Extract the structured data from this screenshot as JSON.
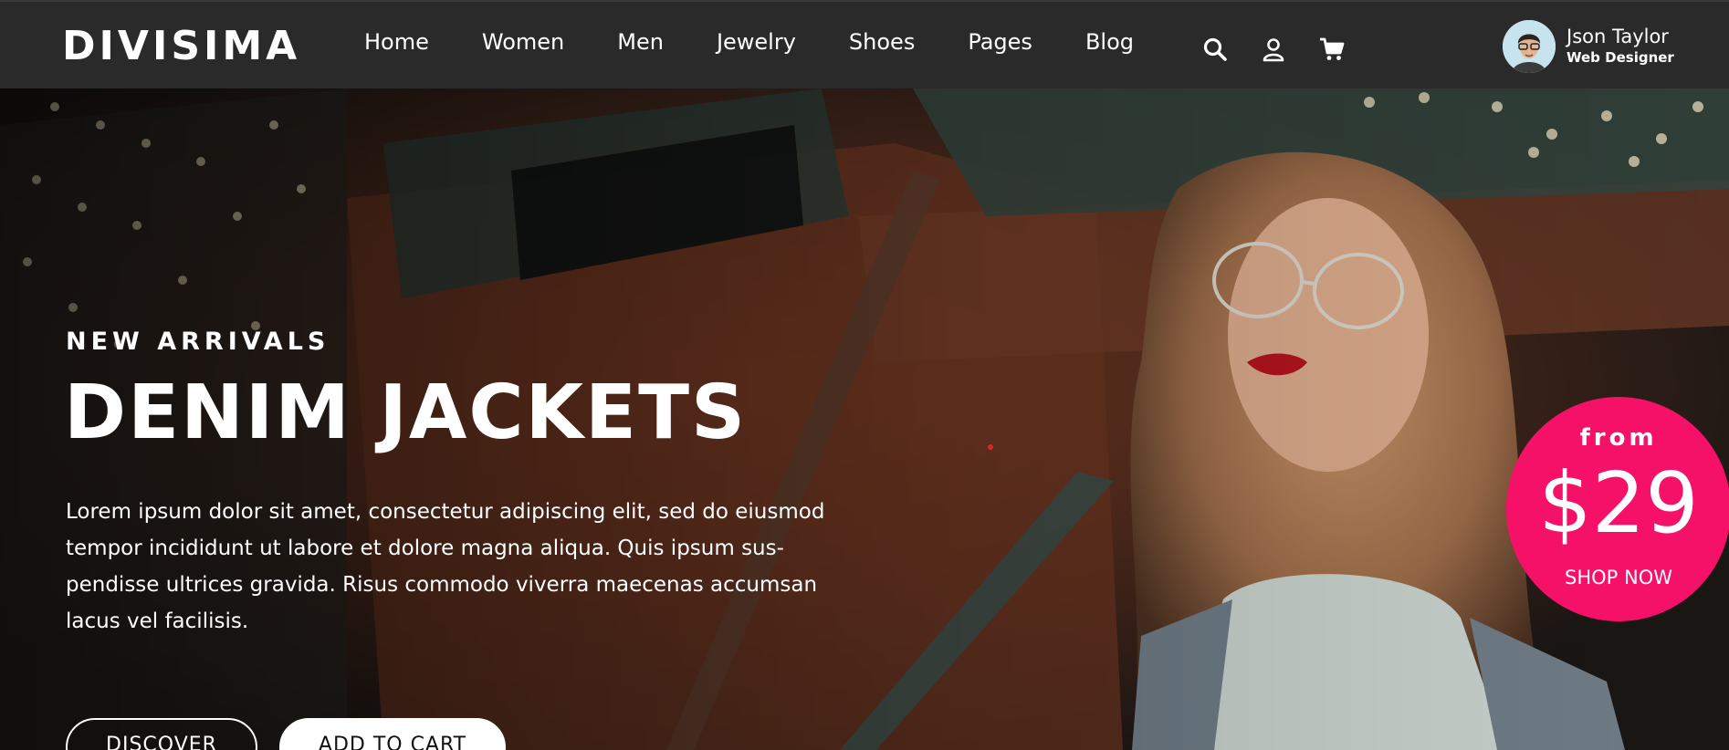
{
  "brand": {
    "logo_text": "DIVISIMA",
    "accent_color": "#f51167"
  },
  "nav": {
    "items": [
      {
        "label": "Home"
      },
      {
        "label": "Women"
      },
      {
        "label": "Men"
      },
      {
        "label": "Jewelry"
      },
      {
        "label": "Shoes"
      },
      {
        "label": "Pages"
      },
      {
        "label": "Blog"
      }
    ],
    "icons": [
      "search-icon",
      "user-icon",
      "cart-icon"
    ]
  },
  "profile": {
    "name": "Json Taylor",
    "role": "Web Designer"
  },
  "hero": {
    "eyebrow": "NEW ARRIVALS",
    "headline": "DENIM JACKETS",
    "description": "Lorem ipsum dolor sit amet, consectetur adipiscing elit, sed do eiusmod tempor incididunt ut labore et dolore magna aliqua. Quis ipsum sus-pendisse ultrices gravida. Risus commodo viverra maecenas accumsan lacus vel facilisis.",
    "discover_label": "DISCOVER",
    "add_to_cart_label": "ADD TO CART"
  },
  "promo": {
    "from_label": "from",
    "price": "$29",
    "cta": "SHOP NOW"
  }
}
